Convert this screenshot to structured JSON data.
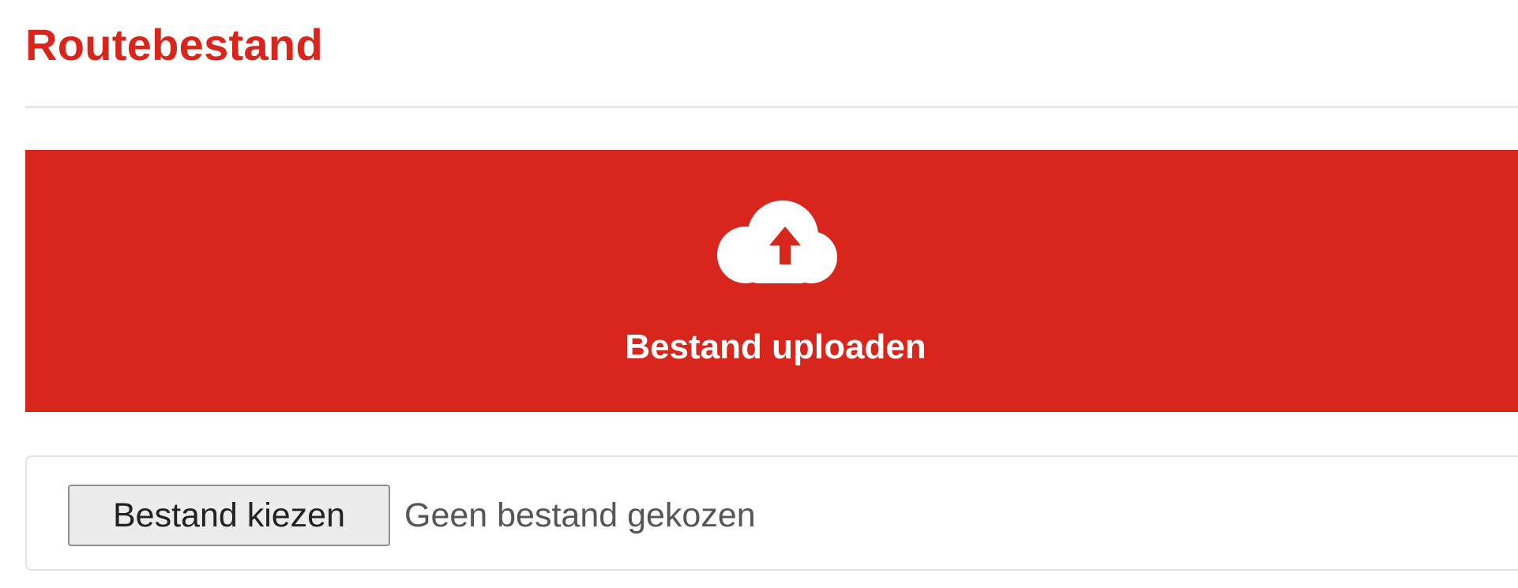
{
  "page": {
    "title": "Routebestand"
  },
  "upload": {
    "icon": "cloud-upload-icon",
    "label": "Bestand uploaden"
  },
  "file_input": {
    "button_label": "Bestand kiezen",
    "status": "Geen bestand gekozen"
  },
  "colors": {
    "accent": "#d9261c",
    "text_on_accent": "#ffffff"
  }
}
